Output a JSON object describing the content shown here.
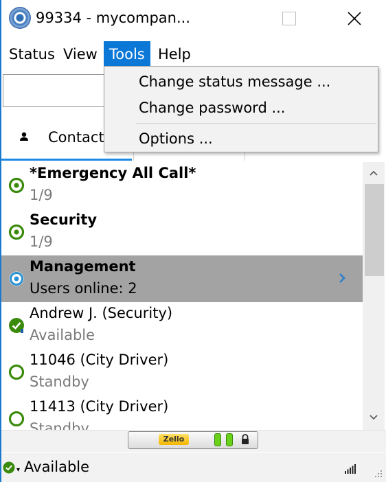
{
  "window": {
    "title": "99334 - mycompan...",
    "close_glyph": "✕"
  },
  "menubar": {
    "items": [
      {
        "label": "Status"
      },
      {
        "label": "View"
      },
      {
        "label": "Tools"
      },
      {
        "label": "Help"
      }
    ],
    "active": "Tools"
  },
  "tools_menu": {
    "items": [
      {
        "label": "Change status message ..."
      },
      {
        "label": "Change password ..."
      },
      {
        "label": "Options ..."
      }
    ]
  },
  "tabs": {
    "contacts_label": "Contact"
  },
  "contacts": [
    {
      "name": "*Emergency All Call*",
      "sub": "1/9",
      "bold": true,
      "status": "channel-online"
    },
    {
      "name": "Security",
      "sub": "1/9",
      "bold": true,
      "status": "channel-online"
    },
    {
      "name": "Management",
      "sub": "Users online: 2",
      "bold": true,
      "status": "channel-selected",
      "selected": true
    },
    {
      "name": "Andrew J. (Security)",
      "sub": "Available",
      "bold": false,
      "status": "user-available"
    },
    {
      "name": "11046 (City Driver)",
      "sub": "Standby",
      "bold": false,
      "status": "user-standby"
    },
    {
      "name": "11413 (City Driver)",
      "sub": "Standby",
      "bold": false,
      "status": "user-standby"
    }
  ],
  "ptt": {
    "logo_text": "Zello"
  },
  "statusbar": {
    "status_text": "Available"
  },
  "colors": {
    "accent": "#0b78d7",
    "online_green": "#3a8a0c",
    "selected_row": "#a3a3a3",
    "selected_status_blue": "#2a8fd0",
    "chevron_blue": "#2f7fc9"
  }
}
